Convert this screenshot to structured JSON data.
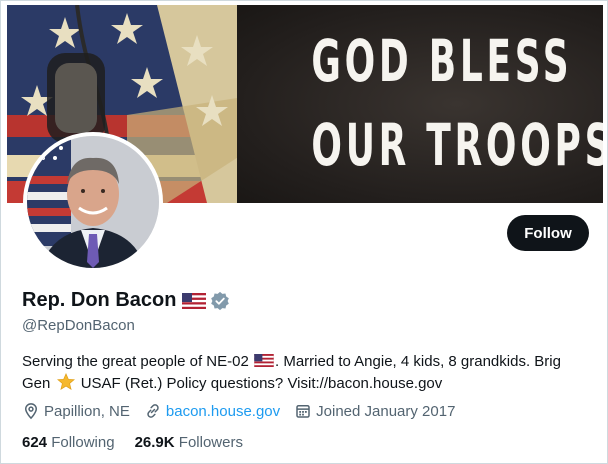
{
  "banner": {
    "line1": "GOD BLESS",
    "line2": "OUR TROOPS"
  },
  "profile": {
    "display_name": "Rep. Don Bacon",
    "handle": "@RepDonBacon",
    "follow_label": "Follow",
    "bio": {
      "part1": "Serving the great people of NE-02 ",
      "part2": ". Married to Angie, 4 kids, 8 grandkids. Brig Gen ",
      "part3": " USAF (Ret.) Policy questions? Visit://bacon.house.gov"
    },
    "location": "Papillion, NE",
    "website": "bacon.house.gov",
    "joined": "Joined January 2017",
    "following_count": "624",
    "following_label": "Following",
    "followers_count": "26.9K",
    "followers_label": "Followers"
  },
  "icons": {
    "name_flag": "us-flag-icon",
    "verified": "verified-badge-icon",
    "location": "location-pin-icon",
    "website": "link-icon",
    "joined": "calendar-icon",
    "bio_star": "star-icon"
  },
  "colors": {
    "accent": "#1d9bf0",
    "text": "#0f1419",
    "secondary": "#536471",
    "button": "#0f1419",
    "verified": "#829aab"
  }
}
